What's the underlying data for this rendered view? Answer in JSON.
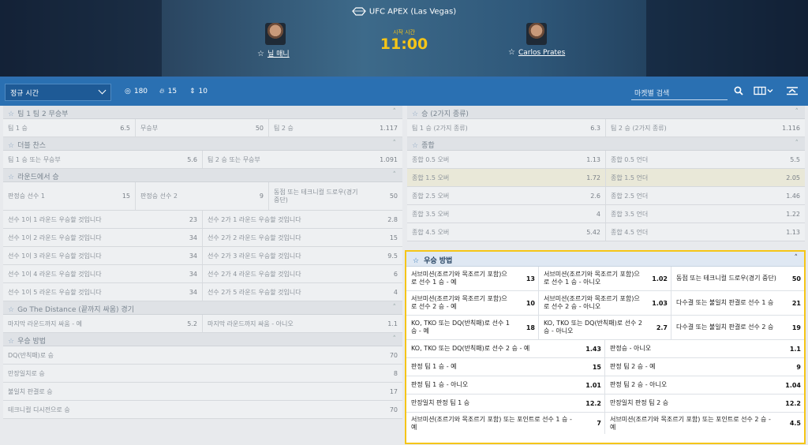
{
  "header": {
    "event_name": "UFC APEX (Las Vegas)",
    "start_label": "시작 시간",
    "start_time": "11:00",
    "fighter1": "닐 매니",
    "fighter2": "Carlos Prates"
  },
  "toolbar": {
    "period": "정규 시간",
    "count_all": "180",
    "count_hot": "15",
    "count_moves": "10",
    "search_placeholder": "마켓별 검색"
  },
  "left": {
    "team_result": {
      "title": "팀 1 팀 2 무승부",
      "cells": [
        [
          "팀 1 승",
          "6.5"
        ],
        [
          "무승부",
          "50"
        ],
        [
          "팀 2 승",
          "1.117"
        ]
      ]
    },
    "double_chance": {
      "title": "더블 찬스",
      "cells": [
        [
          "팀 1 승 또는 무승부",
          "5.6"
        ],
        [
          "팀 2 승 또는 무승부",
          "1.091"
        ]
      ]
    },
    "round_win": {
      "title": "라운드에서 승",
      "top": [
        [
          "판정승 선수 1",
          "15"
        ],
        [
          "판정승 선수 2",
          "9"
        ],
        [
          "동점 또는 테크니컬 드로우(경기 중단)",
          "50"
        ]
      ],
      "rows": [
        [
          [
            "선수 1이 1 라운드 우승할 것입니다",
            "23"
          ],
          [
            "선수 2가 1 라운드 우승할 것입니다",
            "2.8"
          ]
        ],
        [
          [
            "선수 1이 2 라운드 우승할 것입니다",
            "34"
          ],
          [
            "선수 2가 2 라운드 우승할 것입니다",
            "15"
          ]
        ],
        [
          [
            "선수 1이 3 라운드 우승할 것입니다",
            "34"
          ],
          [
            "선수 2가 3 라운드 우승할 것입니다",
            "9.5"
          ]
        ],
        [
          [
            "선수 1이 4 라운드 우승할 것입니다",
            "34"
          ],
          [
            "선수 2가 4 라운드 우승할 것입니다",
            "6"
          ]
        ],
        [
          [
            "선수 1이 5 라운드 우승할 것입니다",
            "34"
          ],
          [
            "선수 2가 5 라운드 우승할 것입니다",
            "4"
          ]
        ]
      ]
    },
    "distance": {
      "title": "Go The Distance (끝까지 싸움) 경기",
      "cells": [
        [
          "마지막 라운드까지 싸움 - 예",
          "5.2"
        ],
        [
          "마지막 라운드까지 싸움 - 아니오",
          "1.1"
        ]
      ]
    },
    "win_method": {
      "title": "우승 방법",
      "rows": [
        [
          "DQ(반칙패)로 승",
          "70"
        ],
        [
          "만장일치로 승",
          "8"
        ],
        [
          "불일치 판결로 승",
          "17"
        ],
        [
          "테크니컬 디시전으로 승",
          "70"
        ]
      ]
    }
  },
  "right": {
    "win2way": {
      "title": "승 (2가지 종류)",
      "cells": [
        [
          "팀 1 승 (2가지 종류)",
          "6.3"
        ],
        [
          "팀 2 승 (2가지 종류)",
          "1.116"
        ]
      ]
    },
    "totals": {
      "title": "종합",
      "rows": [
        [
          [
            "종합 0.5 오버",
            "1.13"
          ],
          [
            "종합 0.5 언더",
            "5.5"
          ]
        ],
        [
          [
            "종합 1.5 오버",
            "1.72"
          ],
          [
            "종합 1.5 언더",
            "2.05"
          ]
        ],
        [
          [
            "종합 2.5 오버",
            "2.6"
          ],
          [
            "종합 2.5 언더",
            "1.46"
          ]
        ],
        [
          [
            "종합 3.5 오버",
            "4"
          ],
          [
            "종합 3.5 언더",
            "1.22"
          ]
        ],
        [
          [
            "종합 4.5 오버",
            "5.42"
          ],
          [
            "종합 4.5 언더",
            "1.13"
          ]
        ]
      ]
    },
    "win_method": {
      "title": "우승 방법",
      "three_rows": [
        [
          [
            "서브미션(조르기와 목조르기 포함)으로 선수 1 승 - 예",
            "13"
          ],
          [
            "서브미션(조르기와 목조르기 포함)으로 선수 1 승 - 아니오",
            "1.02"
          ],
          [
            "동점 또는 테크니컬 드로우(경기 중단)",
            "50"
          ]
        ],
        [
          [
            "서브미션(조르기와 목조르기 포함)으로 선수 2 승 - 예",
            "10"
          ],
          [
            "서브미션(조르기와 목조르기 포함)으로 선수 2 승 - 아니오",
            "1.03"
          ],
          [
            "다수결 또는 불일치 판결로 선수 1 승",
            "21"
          ]
        ],
        [
          [
            "KO, TKO 또는 DQ(반칙패)로 선수 1 승 - 예",
            "18"
          ],
          [
            "KO, TKO 또는 DQ(반칙패)로 선수 2 승 - 아니오",
            "2.7"
          ],
          [
            "다수결 또는 불일치 판결로 선수 2 승",
            "19"
          ]
        ]
      ],
      "two_rows": [
        [
          [
            "KO, TKO 또는 DQ(반칙패)로 선수 2 승 - 예",
            "1.43"
          ],
          [
            "판정승 - 아니오",
            "1.1"
          ]
        ],
        [
          [
            "판정 팀 1 승 - 예",
            "15"
          ],
          [
            "판정 팀 2 승 - 예",
            "9"
          ]
        ],
        [
          [
            "판정 팀 1 승 - 아니오",
            "1.01"
          ],
          [
            "판정 팀 2 승 - 아니오",
            "1.04"
          ]
        ],
        [
          [
            "만장일치 판정 팀 1 승",
            "12.2"
          ],
          [
            "만장일치 판정 팀 2 승",
            "12.2"
          ]
        ],
        [
          [
            "서브미션(조르기와 목조르기 포함) 또는 포인트로 선수 1 승 - 예",
            "7"
          ],
          [
            "서브미션(조르기와 목조르기 포함) 또는 포인트로 선수 2 승 - 예",
            "4.5"
          ]
        ]
      ]
    }
  }
}
